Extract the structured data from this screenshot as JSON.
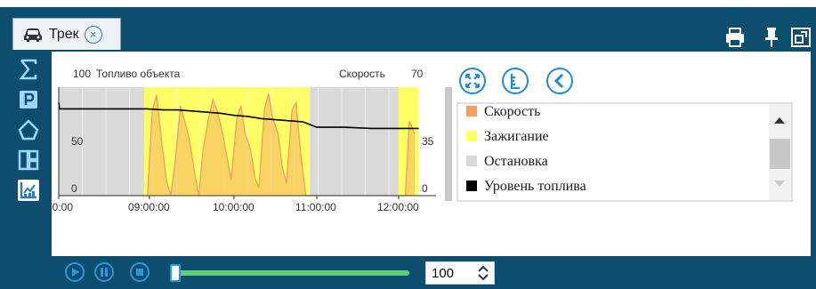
{
  "tab": {
    "label": "Трек",
    "icon": "car-icon",
    "close_icon": "close-circle-icon"
  },
  "toolbar_right": {
    "icons": [
      "printer-icon",
      "pin-icon",
      "window-restore-icon"
    ]
  },
  "sidebar": {
    "items": [
      {
        "icon": "sigma-icon",
        "active": false
      },
      {
        "icon": "parking-icon",
        "active": false
      },
      {
        "icon": "geofence-icon",
        "active": false
      },
      {
        "icon": "dashboard-icon",
        "active": false
      },
      {
        "icon": "chart-icon",
        "active": true
      }
    ]
  },
  "chart_controls": {
    "icons": [
      "zoom-fit-icon",
      "axis-scale-icon",
      "back-icon"
    ]
  },
  "chart_data": {
    "type": "line",
    "left_axis": {
      "label": "Топливо объекта",
      "top_tick": "100",
      "ticks": [
        "100",
        "50",
        "0"
      ],
      "ylim": [
        0,
        100
      ]
    },
    "right_axis": {
      "label": "Скорость",
      "top_tick": "70",
      "ticks": [
        "70",
        "35",
        "0"
      ],
      "ylim": [
        0,
        70
      ]
    },
    "x_ticks": [
      "00:00",
      "09:00:00",
      "10:00:00",
      "11:00:00",
      "12:00:00"
    ],
    "grid": true,
    "series": [
      {
        "name": "Скорость",
        "color": "#f0a060",
        "x": [
          "00:00",
          "08:58",
          "09:02",
          "09:05",
          "09:08",
          "09:12",
          "09:15",
          "09:18",
          "09:22",
          "09:25",
          "09:28",
          "09:32",
          "09:35",
          "09:38",
          "09:42",
          "09:45",
          "09:48",
          "09:52",
          "09:55",
          "09:58",
          "10:02",
          "10:05",
          "10:08",
          "10:12",
          "10:15",
          "10:18",
          "10:22",
          "10:25",
          "10:28",
          "10:32",
          "10:35",
          "10:38",
          "10:42",
          "10:45",
          "10:48",
          "10:52",
          "12:05",
          "12:08",
          "12:12"
        ],
        "values": [
          0,
          0,
          55,
          65,
          40,
          10,
          0,
          20,
          58,
          48,
          38,
          15,
          0,
          30,
          50,
          62,
          55,
          40,
          25,
          10,
          50,
          58,
          40,
          30,
          12,
          5,
          55,
          66,
          50,
          40,
          18,
          8,
          55,
          60,
          30,
          0,
          0,
          48,
          40
        ]
      },
      {
        "name": "Уровень топлива",
        "color": "#000000",
        "x": [
          "00:00",
          "00:05",
          "08:58",
          "09:10",
          "09:20",
          "09:30",
          "09:40",
          "09:50",
          "10:00",
          "10:10",
          "10:20",
          "10:30",
          "10:40",
          "10:50",
          "11:00",
          "11:20",
          "11:40",
          "12:00",
          "12:15"
        ],
        "values": [
          86,
          80,
          80,
          79,
          79,
          78,
          77,
          76,
          74,
          73,
          71,
          70,
          69,
          68,
          63,
          63,
          62,
          62,
          62
        ]
      }
    ],
    "bands": [
      {
        "name": "Зажигание",
        "color": "#ffff66",
        "ranges": [
          [
            "00:00",
            "00:03"
          ],
          [
            "08:55",
            "10:55"
          ],
          [
            "12:00",
            "12:15"
          ]
        ]
      },
      {
        "name": "Остановка",
        "color": "#d9d9d9",
        "ranges": [
          [
            "00:03",
            "08:55"
          ],
          [
            "10:55",
            "12:00"
          ]
        ]
      }
    ],
    "legend": [
      {
        "label": "Скорость",
        "color": "#f0a060"
      },
      {
        "label": "Зажигание",
        "color": "#ffff66"
      },
      {
        "label": "Остановка",
        "color": "#d9d9d9"
      },
      {
        "label": "Уровень топлива",
        "color": "#000000"
      }
    ]
  },
  "playback": {
    "icons": [
      "play-icon",
      "pause-icon",
      "stop-icon"
    ],
    "progress": 0.0,
    "speed_value": "100"
  }
}
